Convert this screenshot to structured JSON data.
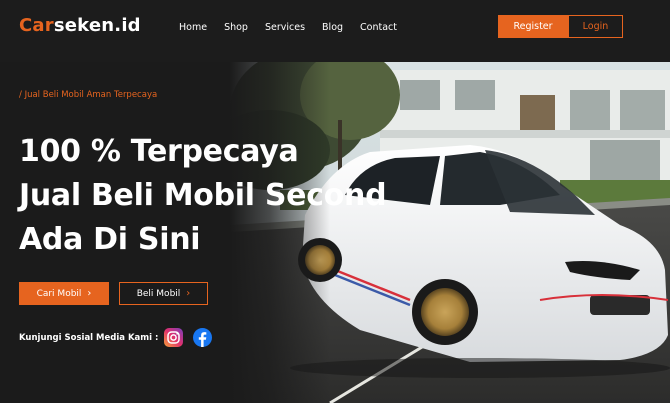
{
  "brand": {
    "part1": "Car",
    "part2": "seken.id"
  },
  "nav": {
    "items": [
      "Home",
      "Shop",
      "Services",
      "Blog",
      "Contact"
    ]
  },
  "auth": {
    "register": "Register",
    "login": "Login"
  },
  "hero": {
    "tagline": "/ Jual  Beli Mobil Aman Terpecaya",
    "headline": [
      "100 % Terpecaya",
      "Jual Beli Mobil Second",
      "Ada Di Sini"
    ],
    "cari_label": "Cari Mobil",
    "beli_label": "Beli Mobil"
  },
  "social": {
    "label": "Kunjungi Sosial Media Kami :",
    "icons": [
      "instagram-icon",
      "facebook-icon"
    ]
  },
  "colors": {
    "accent": "#e6641f",
    "background": "#1b1b1b",
    "text": "#ffffff"
  }
}
